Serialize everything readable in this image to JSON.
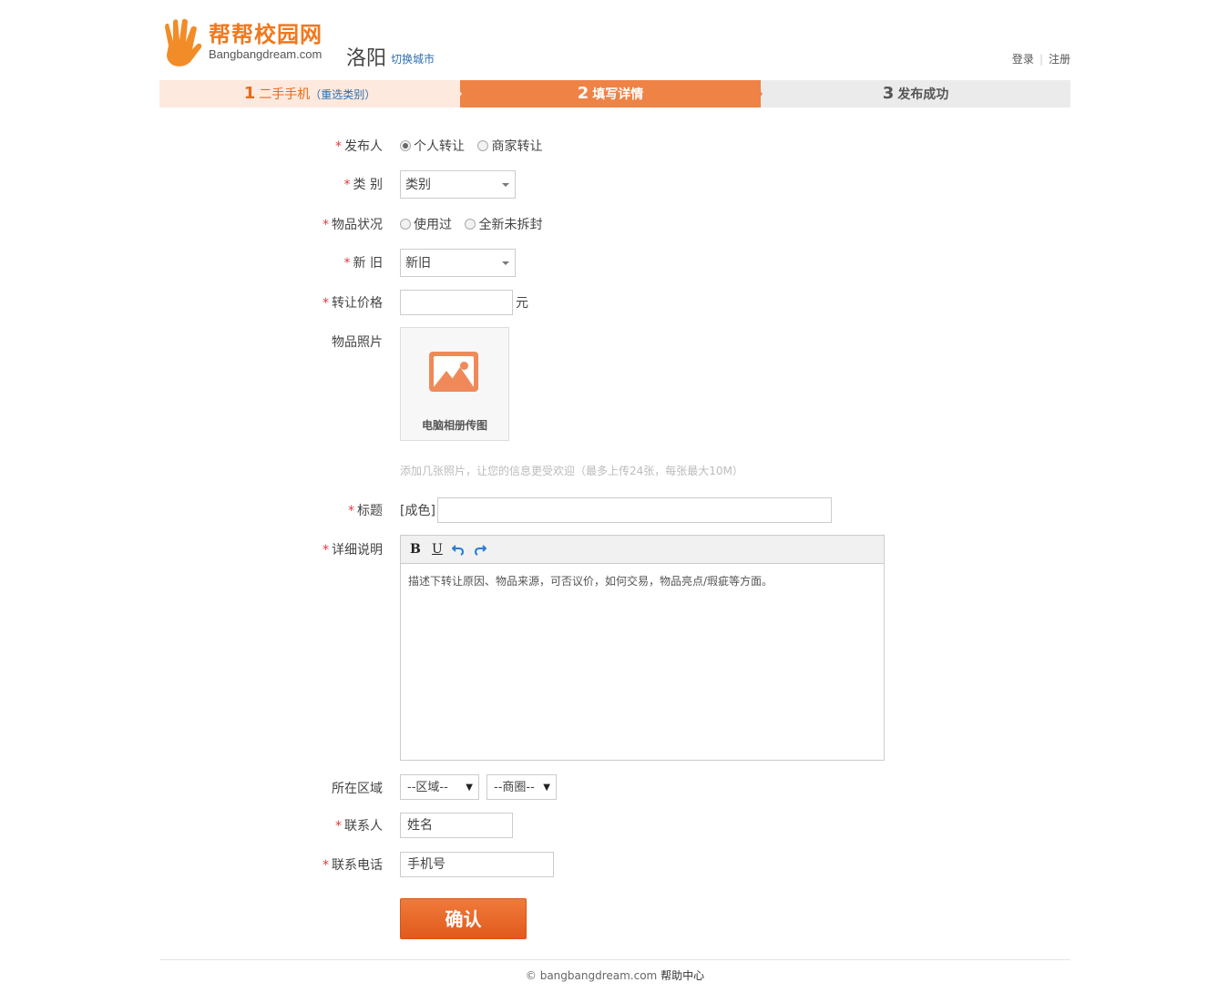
{
  "header": {
    "logo_cn": "帮帮校园网",
    "logo_en": "Bangbangdream.com",
    "city": "洛阳",
    "switch_city": "切换城市",
    "login": "登录",
    "register": "注册"
  },
  "steps": [
    {
      "num": "1",
      "label": "二手手机",
      "extra": "（重选类别）"
    },
    {
      "num": "2",
      "label": "填写详情"
    },
    {
      "num": "3",
      "label": "发布成功"
    }
  ],
  "form": {
    "publisher": {
      "label": "发布人",
      "options": [
        "个人转让",
        "商家转让"
      ],
      "selected": "个人转让"
    },
    "category": {
      "label": "类 别",
      "value": "类别"
    },
    "condition": {
      "label": "物品状况",
      "options": [
        "使用过",
        "全新未拆封"
      ]
    },
    "newness": {
      "label": "新 旧",
      "value": "新旧"
    },
    "price": {
      "label": "转让价格",
      "value": "",
      "unit": "元"
    },
    "photos": {
      "label": "物品照片",
      "upload_caption": "电脑相册传图",
      "hint": "添加几张照片，让您的信息更受欢迎（最多上传24张，每张最大10M）"
    },
    "title": {
      "label": "标题",
      "prefix": "[成色]",
      "value": ""
    },
    "detail": {
      "label": "详细说明",
      "toolbar": [
        "B",
        "U",
        "undo",
        "redo"
      ],
      "placeholder": "描述下转让原因、物品来源，可否议价，如何交易，物品亮点/瑕疵等方面。"
    },
    "area": {
      "label": "所在区域",
      "district": "--区域--",
      "business": "--商圈--"
    },
    "contact": {
      "label": "联系人",
      "placeholder": "姓名"
    },
    "phone": {
      "label": "联系电话",
      "placeholder": "手机号"
    },
    "submit": "确认"
  },
  "footer": {
    "copyright": "© bangbangdream.com",
    "help": "帮助中心"
  },
  "colors": {
    "accent": "#ef8245",
    "link": "#2a6fb3",
    "required": "#e4393c"
  }
}
